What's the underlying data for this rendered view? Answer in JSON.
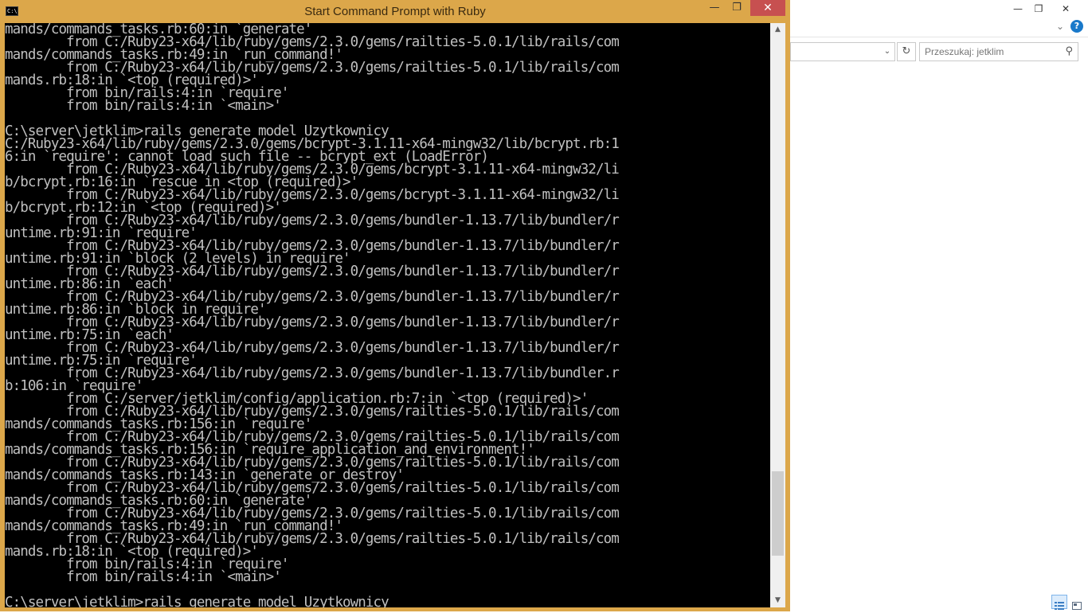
{
  "explorer": {
    "minimize_glyph": "—",
    "maximize_glyph": "❐",
    "close_glyph": "✕",
    "help_glyph": "?",
    "search_placeholder": "Przeszukaj: jetklim",
    "refresh_glyph": "↻",
    "search_glyph": "⚲",
    "dropdown_glyph": "⌄"
  },
  "console": {
    "title": "Start Command Prompt with Ruby",
    "icon_text": "C:\\",
    "minimize_glyph": "—",
    "maximize_glyph": "❐",
    "close_glyph": "✕",
    "scroll": {
      "up_glyph": "▲",
      "down_glyph": "▼",
      "position_fraction": 0.92
    },
    "lines": [
      "mands/commands_tasks.rb:60:in `generate'",
      "        from C:/Ruby23-x64/lib/ruby/gems/2.3.0/gems/railties-5.0.1/lib/rails/com",
      "mands/commands_tasks.rb:49:in `run_command!'",
      "        from C:/Ruby23-x64/lib/ruby/gems/2.3.0/gems/railties-5.0.1/lib/rails/com",
      "mands.rb:18:in `<top (required)>'",
      "        from bin/rails:4:in `require'",
      "        from bin/rails:4:in `<main>'",
      "",
      "C:\\server\\jetklim>rails generate model Uzytkownicy",
      "C:/Ruby23-x64/lib/ruby/gems/2.3.0/gems/bcrypt-3.1.11-x64-mingw32/lib/bcrypt.rb:1",
      "6:in `require': cannot load such file -- bcrypt_ext (LoadError)",
      "        from C:/Ruby23-x64/lib/ruby/gems/2.3.0/gems/bcrypt-3.1.11-x64-mingw32/li",
      "b/bcrypt.rb:16:in `rescue in <top (required)>'",
      "        from C:/Ruby23-x64/lib/ruby/gems/2.3.0/gems/bcrypt-3.1.11-x64-mingw32/li",
      "b/bcrypt.rb:12:in `<top (required)>'",
      "        from C:/Ruby23-x64/lib/ruby/gems/2.3.0/gems/bundler-1.13.7/lib/bundler/r",
      "untime.rb:91:in `require'",
      "        from C:/Ruby23-x64/lib/ruby/gems/2.3.0/gems/bundler-1.13.7/lib/bundler/r",
      "untime.rb:91:in `block (2 levels) in require'",
      "        from C:/Ruby23-x64/lib/ruby/gems/2.3.0/gems/bundler-1.13.7/lib/bundler/r",
      "untime.rb:86:in `each'",
      "        from C:/Ruby23-x64/lib/ruby/gems/2.3.0/gems/bundler-1.13.7/lib/bundler/r",
      "untime.rb:86:in `block in require'",
      "        from C:/Ruby23-x64/lib/ruby/gems/2.3.0/gems/bundler-1.13.7/lib/bundler/r",
      "untime.rb:75:in `each'",
      "        from C:/Ruby23-x64/lib/ruby/gems/2.3.0/gems/bundler-1.13.7/lib/bundler/r",
      "untime.rb:75:in `require'",
      "        from C:/Ruby23-x64/lib/ruby/gems/2.3.0/gems/bundler-1.13.7/lib/bundler.r",
      "b:106:in `require'",
      "        from C:/server/jetklim/config/application.rb:7:in `<top (required)>'",
      "        from C:/Ruby23-x64/lib/ruby/gems/2.3.0/gems/railties-5.0.1/lib/rails/com",
      "mands/commands_tasks.rb:156:in `require'",
      "        from C:/Ruby23-x64/lib/ruby/gems/2.3.0/gems/railties-5.0.1/lib/rails/com",
      "mands/commands_tasks.rb:156:in `require_application_and_environment!'",
      "        from C:/Ruby23-x64/lib/ruby/gems/2.3.0/gems/railties-5.0.1/lib/rails/com",
      "mands/commands_tasks.rb:143:in `generate_or_destroy'",
      "        from C:/Ruby23-x64/lib/ruby/gems/2.3.0/gems/railties-5.0.1/lib/rails/com",
      "mands/commands_tasks.rb:60:in `generate'",
      "        from C:/Ruby23-x64/lib/ruby/gems/2.3.0/gems/railties-5.0.1/lib/rails/com",
      "mands/commands_tasks.rb:49:in `run_command!'",
      "        from C:/Ruby23-x64/lib/ruby/gems/2.3.0/gems/railties-5.0.1/lib/rails/com",
      "mands.rb:18:in `<top (required)>'",
      "        from bin/rails:4:in `require'",
      "        from bin/rails:4:in `<main>'",
      "",
      "C:\\server\\jetklim>rails generate model Uzytkownicy"
    ]
  },
  "colors": {
    "console_frame": "#dca74a",
    "console_bg": "#000000",
    "console_text": "#c0c0c0",
    "close_button": "#c75050"
  }
}
